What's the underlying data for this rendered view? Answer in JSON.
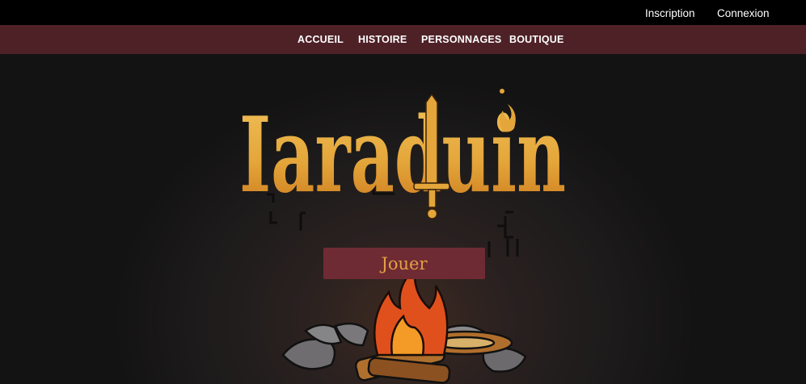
{
  "auth": {
    "register_label": "Inscription",
    "login_label": "Connexion"
  },
  "nav": {
    "items": [
      "ACCUEIL",
      "HISTOIRE",
      "PERSONNAGES",
      "BOUTIQUE"
    ]
  },
  "hero": {
    "logo_text": "Iaraduin",
    "play_label": "Jouer"
  },
  "colors": {
    "topbar": "#000000",
    "navbar": "#4e2127",
    "button": "#6f2b33",
    "logo_gold": "#e4a63a",
    "button_text": "#e59f46"
  },
  "icons": [
    "sword-icon",
    "flame-icon",
    "campfire-illustration",
    "stone-wall-illustration"
  ]
}
